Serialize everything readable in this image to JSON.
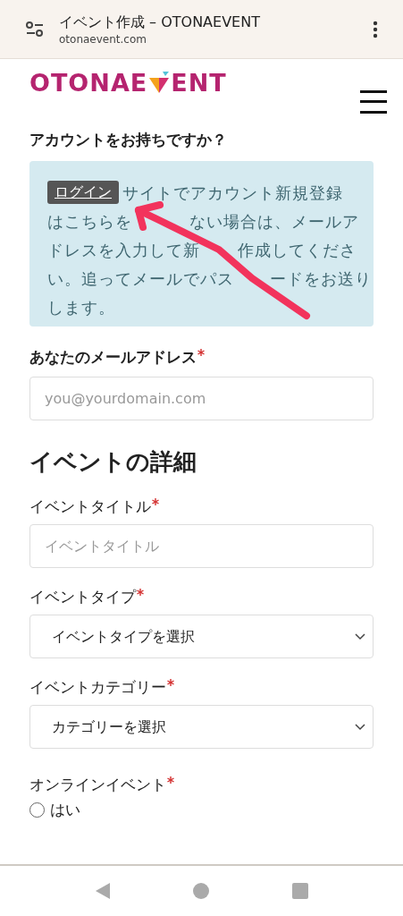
{
  "browser": {
    "title": "イベント作成 – OTONAEVENT",
    "url": "otonaevent.com"
  },
  "logo": {
    "left": "OTONAE",
    "right": "ENT"
  },
  "account": {
    "heading": "アカウントをお持ちですか？",
    "login_button": "ログイン",
    "message_lines": [
      [
        "サイトでアカウント新規登録"
      ],
      [
        "はこちらを",
        "ない場合は、メールア"
      ],
      [
        "ドレスを入力して新",
        "作成してくださ"
      ],
      [
        "い。追ってメールでパス",
        "ードをお送り"
      ],
      [
        "します。"
      ]
    ]
  },
  "email": {
    "label": "あなたのメールアドレス",
    "required": true,
    "placeholder": "you@yourdomain.com"
  },
  "details_heading": "イベントの詳細",
  "fields": [
    {
      "kind": "text",
      "label": "イベントタイトル",
      "required": true,
      "placeholder": "イベントタイトル"
    },
    {
      "kind": "select",
      "label": "イベントタイプ",
      "required": true,
      "value": "イベントタイプを選択"
    },
    {
      "kind": "select",
      "label": "イベントカテゴリー",
      "required": true,
      "value": "カテゴリーを選択"
    }
  ],
  "online": {
    "label": "オンラインイベント",
    "required": true,
    "options": [
      {
        "label": "はい",
        "selected": false
      }
    ]
  }
}
